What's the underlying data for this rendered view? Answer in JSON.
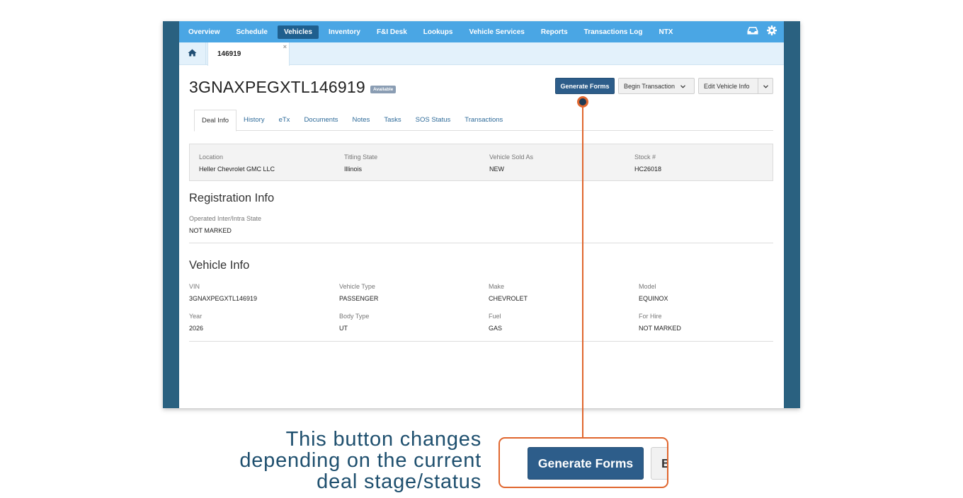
{
  "nav": {
    "items": [
      {
        "label": "Overview",
        "active": false
      },
      {
        "label": "Schedule",
        "active": false
      },
      {
        "label": "Vehicles",
        "active": true
      },
      {
        "label": "Inventory",
        "active": false
      },
      {
        "label": "F&I Desk",
        "active": false
      },
      {
        "label": "Lookups",
        "active": false
      },
      {
        "label": "Vehicle Services",
        "active": false
      },
      {
        "label": "Reports",
        "active": false
      },
      {
        "label": "Transactions Log",
        "active": false
      },
      {
        "label": "NTX",
        "active": false
      }
    ],
    "icons": [
      "inbox-icon",
      "gear-icon"
    ]
  },
  "tabs": {
    "home_icon": "home-icon",
    "open_tab": "146919",
    "close_glyph": "×"
  },
  "header": {
    "vin": "3GNAXPEGXTL146919",
    "status_badge": "Available",
    "primary_button": "Generate Forms",
    "begin_button": "Begin Transaction",
    "edit_button": "Edit Vehicle Info"
  },
  "subtabs": [
    {
      "label": "Deal Info",
      "active": true
    },
    {
      "label": "History",
      "active": false
    },
    {
      "label": "eTx",
      "active": false
    },
    {
      "label": "Documents",
      "active": false
    },
    {
      "label": "Notes",
      "active": false
    },
    {
      "label": "Tasks",
      "active": false
    },
    {
      "label": "SOS Status",
      "active": false
    },
    {
      "label": "Transactions",
      "active": false
    }
  ],
  "deal_info": {
    "location_label": "Location",
    "location_value": "Heller Chevrolet GMC LLC",
    "titling_label": "Titling State",
    "titling_value": "Illinois",
    "sold_as_label": "Vehicle Sold As",
    "sold_as_value": "NEW",
    "stock_label": "Stock #",
    "stock_value": "HC26018"
  },
  "registration": {
    "title": "Registration Info",
    "operated_label": "Operated Inter/Intra State",
    "operated_value": "NOT MARKED"
  },
  "vehicle_info": {
    "title": "Vehicle Info",
    "vin_label": "VIN",
    "vin_value": "3GNAXPEGXTL146919",
    "type_label": "Vehicle Type",
    "type_value": "PASSENGER",
    "make_label": "Make",
    "make_value": "CHEVROLET",
    "model_label": "Model",
    "model_value": "EQUINOX",
    "year_label": "Year",
    "year_value": "2026",
    "body_label": "Body Type",
    "body_value": "UT",
    "fuel_label": "Fuel",
    "fuel_value": "GAS",
    "hire_label": "For Hire",
    "hire_value": "NOT MARKED"
  },
  "callout": {
    "line1": "This button changes",
    "line2": "depending on the current",
    "line3": "deal stage/status",
    "zoom_button": "Generate Forms",
    "zoom_partial": "B"
  },
  "colors": {
    "nav_bg": "#4aa6e4",
    "nav_active": "#1f5f8e",
    "frame": "#2a6180",
    "primary": "#2d5d8a",
    "callout_accent": "#e0662e",
    "callout_text": "#1e4f6e"
  }
}
